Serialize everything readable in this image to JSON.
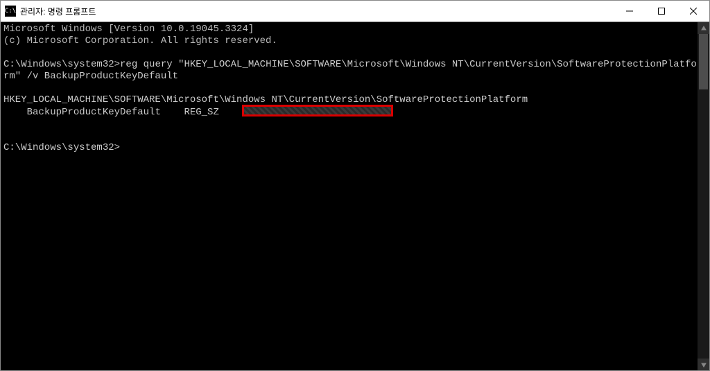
{
  "titlebar": {
    "icon_text": "C:\\",
    "title": "관리자: 명령 프롬프트"
  },
  "terminal": {
    "line1": "Microsoft Windows [Version 10.0.19045.3324]",
    "line2": "(c) Microsoft Corporation. All rights reserved.",
    "prompt1": "C:\\Windows\\system32>",
    "cmd1": "reg query \"HKEY_LOCAL_MACHINE\\SOFTWARE\\Microsoft\\Windows NT\\CurrentVersion\\SoftwareProtectionPlatform\" /v BackupProductKeyDefault",
    "result_key": "HKEY_LOCAL_MACHINE\\SOFTWARE\\Microsoft\\Windows NT\\CurrentVersion\\SoftwareProtectionPlatform",
    "result_value_name": "    BackupProductKeyDefault",
    "result_value_type": "    REG_SZ",
    "prompt2": "C:\\Windows\\system32>"
  }
}
